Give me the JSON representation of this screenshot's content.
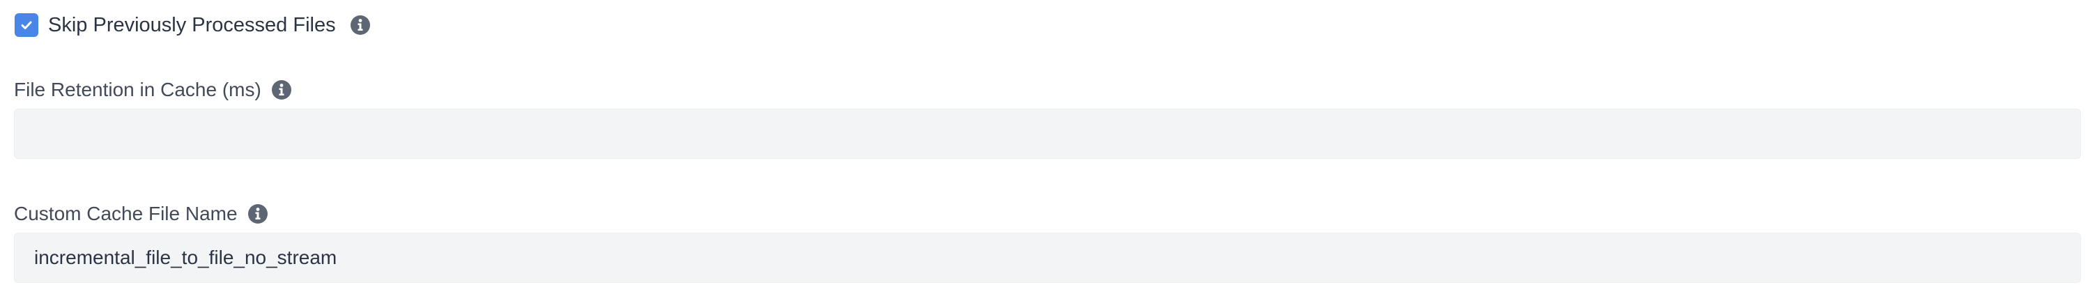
{
  "skip_processed": {
    "label": "Skip Previously Processed Files",
    "checked": true,
    "info_icon": "info-icon"
  },
  "file_retention": {
    "label": "File Retention in Cache (ms)",
    "value": "",
    "info_icon": "info-icon"
  },
  "custom_cache_file_name": {
    "label": "Custom Cache File Name",
    "value": "incremental_file_to_file_no_stream",
    "info_icon": "info-icon"
  },
  "colors": {
    "checkbox_accent": "#4a86e8",
    "input_background": "#f3f4f6",
    "label_text": "#424a59",
    "icon": "#5f6673"
  }
}
